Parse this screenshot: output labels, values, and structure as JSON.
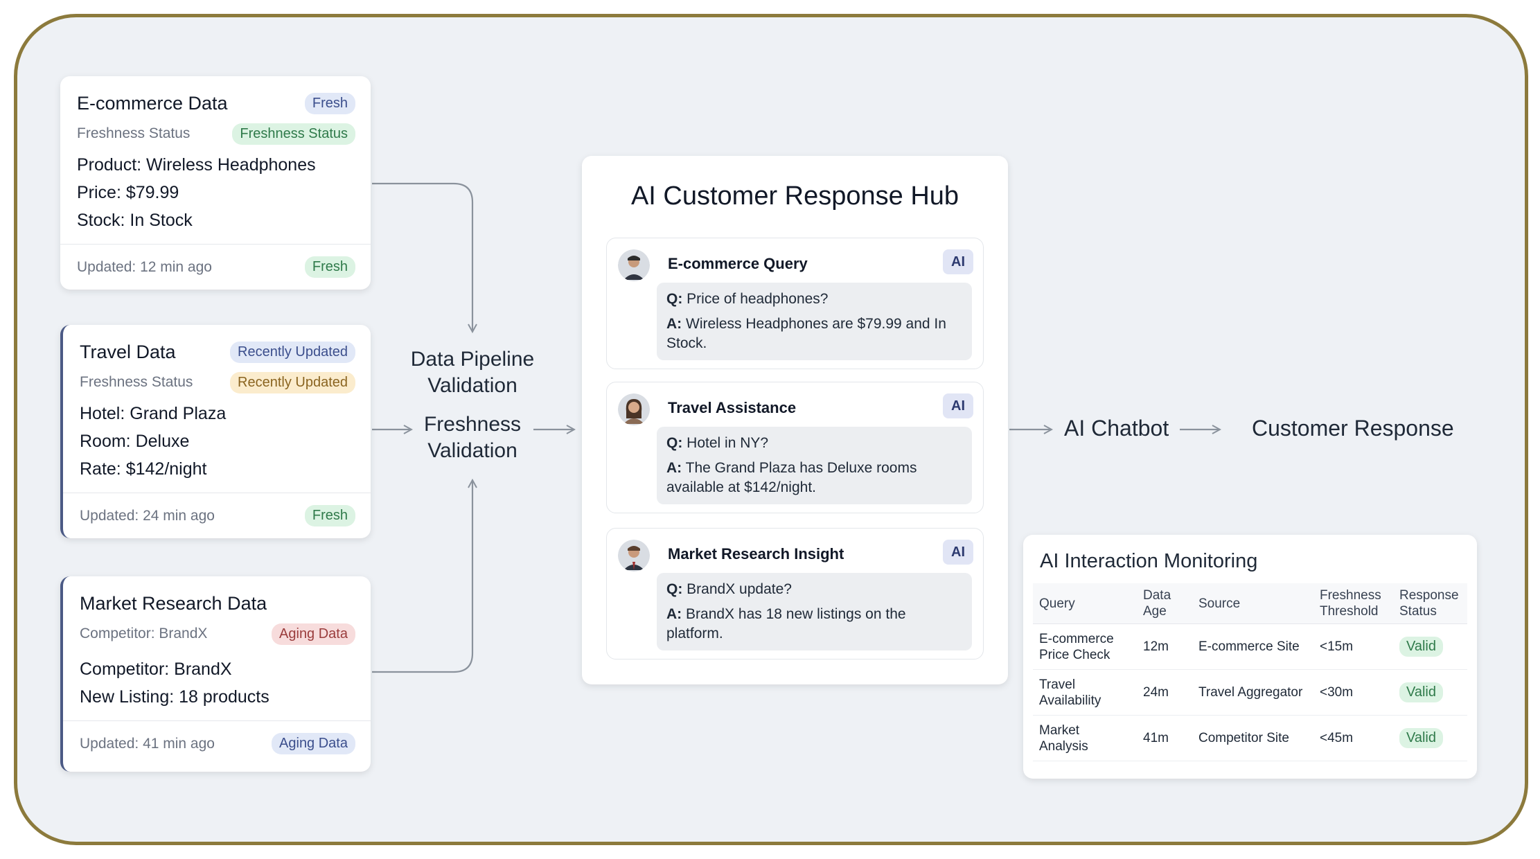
{
  "sources": [
    {
      "title": "E-commerce Data",
      "badge": "Fresh",
      "status_label": "Freshness Status",
      "status_badge": "Freshness Status",
      "lines": [
        "Product: Wireless Headphones",
        "Price: $79.99",
        "Stock: In Stock"
      ],
      "updated": "Updated: 12 min ago",
      "footer_badge": "Fresh"
    },
    {
      "title": "Travel Data",
      "badge": "Recently Updated",
      "status_label": "Freshness Status",
      "status_badge": "Recently Updated",
      "lines": [
        "Hotel: Grand Plaza",
        "Room: Deluxe",
        "Rate: $142/night"
      ],
      "updated": "Updated: 24 min ago",
      "footer_badge": "Fresh"
    },
    {
      "title": "Market Research Data",
      "status_label": "Competitor: BrandX",
      "status_badge": "Aging Data",
      "lines": [
        "Competitor: BrandX",
        "New Listing: 18 products"
      ],
      "updated": "Updated: 41 min ago",
      "footer_badge": "Aging Data"
    }
  ],
  "pipeline": {
    "label1": [
      "Data Pipeline",
      "Validation"
    ],
    "label2": [
      "Freshness",
      "Validation"
    ]
  },
  "hub": {
    "title": "AI Customer Response Hub",
    "queries": [
      {
        "title": "E-commerce Query",
        "badge": "AI",
        "q_prefix": "Q:",
        "q": "Price of headphones?",
        "a_prefix": "A:",
        "a": "Wireless Headphones are $79.99 and In Stock."
      },
      {
        "title": "Travel Assistance",
        "badge": "AI",
        "q_prefix": "Q:",
        "q": "Hotel in NY?",
        "a_prefix": "A:",
        "a": "The Grand Plaza has Deluxe rooms available at $142/night."
      },
      {
        "title": "Market Research Insight",
        "badge": "AI",
        "q_prefix": "Q:",
        "q": "BrandX update?",
        "a_prefix": "A:",
        "a": "BrandX has 18 new listings on the platform."
      }
    ]
  },
  "flow": {
    "chatbot": "AI Chatbot",
    "response": "Customer Response"
  },
  "monitoring": {
    "title": "AI Interaction Monitoring",
    "headers": [
      "Query",
      "Data Age",
      "Source",
      "Freshness Threshold",
      "Response Status"
    ],
    "rows": [
      [
        "E-commerce Price Check",
        "12m",
        "E-commerce Site",
        "<15m",
        "Valid"
      ],
      [
        "Travel Availability",
        "24m",
        "Travel Aggregator",
        "<30m",
        "Valid"
      ],
      [
        "Market Analysis",
        "41m",
        "Competitor Site",
        "<45m",
        "Valid"
      ]
    ]
  },
  "colors": {
    "frame_border": "#8c7a3c",
    "background": "#eef1f5",
    "accent": "#4b5a85",
    "valid_green": "#2f7a4a"
  }
}
